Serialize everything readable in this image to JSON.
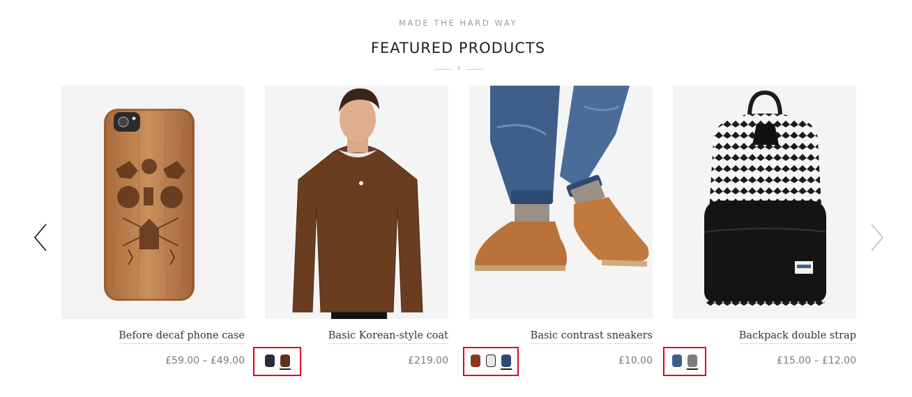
{
  "header": {
    "subtitle": "MADE THE HARD WAY",
    "title": "FEATURED PRODUCTS",
    "divider_glyph": "×"
  },
  "nav": {
    "prev_icon": "chevron-left-icon",
    "next_icon": "chevron-right-icon"
  },
  "products": [
    {
      "name": "Before decaf phone case",
      "price": "£59.00 – £49.00",
      "image": "wooden-phone-case",
      "swatches": []
    },
    {
      "name": "Basic Korean-style coat",
      "price": "£219.00",
      "image": "brown-sweater-model",
      "swatches": [
        {
          "color": "#2b2d38",
          "active": false
        },
        {
          "color": "#5a3320",
          "active": true
        }
      ]
    },
    {
      "name": "Basic contrast sneakers",
      "price": "£10.00",
      "image": "tan-chukka-boots",
      "swatches": [
        {
          "color": "#8b3a22",
          "active": false
        },
        {
          "color": "#e8e8e8",
          "active": false
        },
        {
          "color": "#2f4a78",
          "active": true
        }
      ]
    },
    {
      "name": "Backpack double strap",
      "price": "£15.00 – £12.00",
      "image": "patterned-backpack",
      "swatches": [
        {
          "color": "#3a5f88",
          "active": false
        },
        {
          "color": "#7d7d7d",
          "active": true
        }
      ]
    }
  ]
}
